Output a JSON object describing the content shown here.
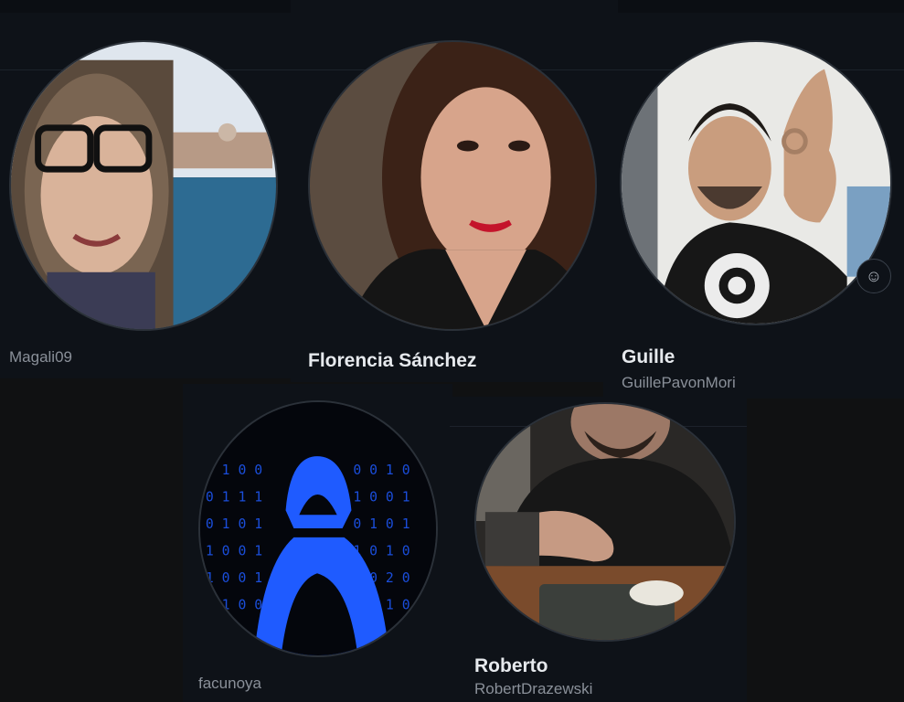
{
  "participants": [
    {
      "display_name": "",
      "handle": "Magali09"
    },
    {
      "display_name": "Florencia Sánchez",
      "handle": ""
    },
    {
      "display_name": "Guille",
      "handle": "GuillePavonMori"
    },
    {
      "display_name": "",
      "handle": "facunoya"
    },
    {
      "display_name": "Roberto",
      "handle": "RobertDrazewski"
    }
  ],
  "reaction_icon": "smiley-icon",
  "reaction_glyph": "☺",
  "colors": {
    "panel": "#0e1218",
    "background": "#101112",
    "name": "#e6e9ed",
    "handle": "#8a9099",
    "hacker_blue": "#1f5bff"
  }
}
